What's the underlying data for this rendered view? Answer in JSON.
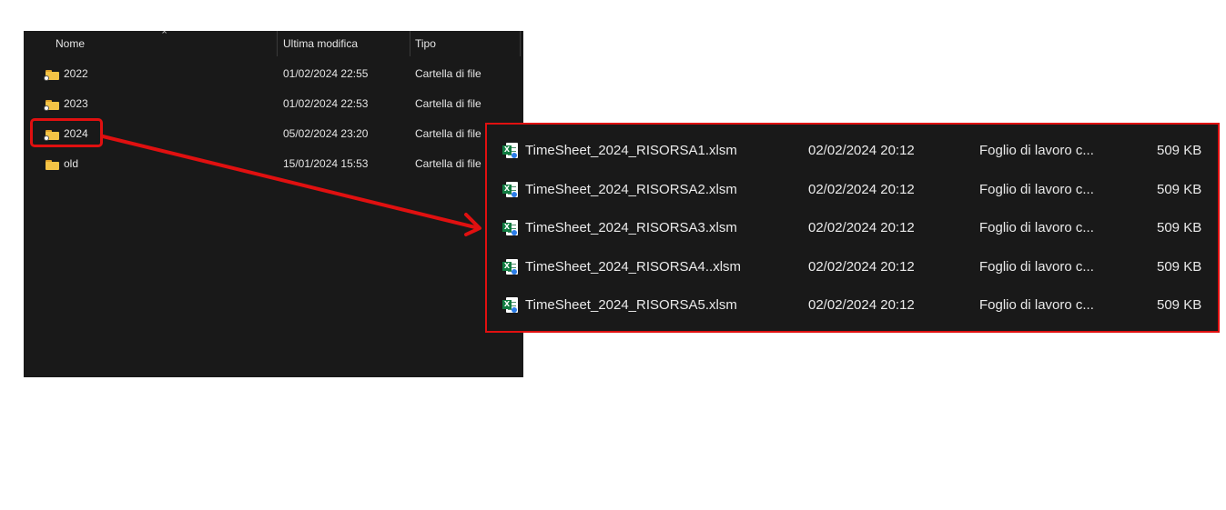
{
  "explorer": {
    "columns": {
      "name": "Nome",
      "modified": "Ultima modifica",
      "type": "Tipo"
    },
    "rows": [
      {
        "name": "2022",
        "modified": "01/02/2024 22:55",
        "type": "Cartella di file",
        "icon": "folder-sync-icon"
      },
      {
        "name": "2023",
        "modified": "01/02/2024 22:53",
        "type": "Cartella di file",
        "icon": "folder-sync-icon"
      },
      {
        "name": "2024",
        "modified": "05/02/2024 23:20",
        "type": "Cartella di file",
        "icon": "folder-sync-icon"
      },
      {
        "name": "old",
        "modified": "15/01/2024 15:53",
        "type": "Cartella di file",
        "icon": "folder-icon"
      }
    ]
  },
  "zoom": {
    "files": [
      {
        "name": "TimeSheet_2024_RISORSA1.xlsm",
        "modified": "02/02/2024 20:12",
        "type": "Foglio di lavoro c...",
        "size": "509 KB",
        "icon": "excel-macro-icon"
      },
      {
        "name": "TimeSheet_2024_RISORSA2.xlsm",
        "modified": "02/02/2024 20:12",
        "type": "Foglio di lavoro c...",
        "size": "509 KB",
        "icon": "excel-macro-icon"
      },
      {
        "name": "TimeSheet_2024_RISORSA3.xlsm",
        "modified": "02/02/2024 20:12",
        "type": "Foglio di lavoro c...",
        "size": "509 KB",
        "icon": "excel-macro-icon"
      },
      {
        "name": "TimeSheet_2024_RISORSA4..xlsm",
        "modified": "02/02/2024 20:12",
        "type": "Foglio di lavoro c...",
        "size": "509 KB",
        "icon": "excel-macro-icon"
      },
      {
        "name": "TimeSheet_2024_RISORSA5.xlsm",
        "modified": "02/02/2024 20:12",
        "type": "Foglio di lavoro c...",
        "size": "509 KB",
        "icon": "excel-macro-icon"
      }
    ]
  },
  "colors": {
    "highlight": "#e01010",
    "panel_bg": "#191919",
    "folder": "#f5c446",
    "excel": "#107c41"
  }
}
